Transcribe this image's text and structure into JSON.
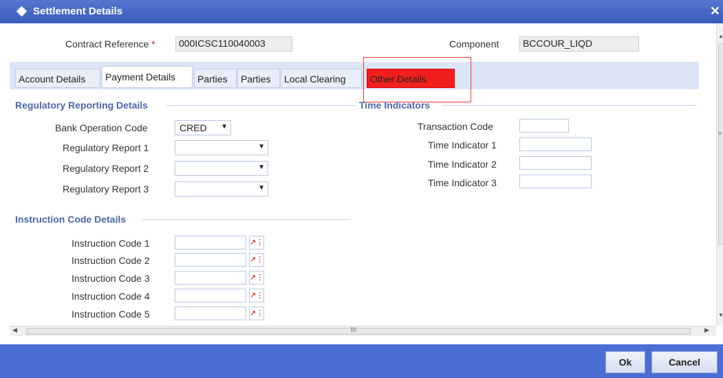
{
  "window": {
    "title": "Settlement Details",
    "close_glyph": "✕"
  },
  "header": {
    "contract_reference_label": "Contract Reference",
    "required_marker": "*",
    "contract_reference_value": "000ICSC110040003",
    "component_label": "Component",
    "component_value": "BCCOUR_LIQD"
  },
  "tabs": [
    {
      "label": "Account Details"
    },
    {
      "label": "Payment Details"
    },
    {
      "label": "Parties"
    },
    {
      "label": "Parties"
    },
    {
      "label": "Local Clearing"
    },
    {
      "label": "Other Details"
    }
  ],
  "regulatory": {
    "title": "Regulatory Reporting Details",
    "bank_operation_code_label": "Bank Operation Code",
    "bank_operation_code_value": "CRED",
    "report1_label": "Regulatory Report 1",
    "report2_label": "Regulatory Report 2",
    "report3_label": "Regulatory Report 3"
  },
  "time_indicators": {
    "title": "Time Indicators",
    "transaction_code_label": "Transaction Code",
    "ti1_label": "Time Indicator 1",
    "ti2_label": "Time Indicator 2",
    "ti3_label": "Time Indicator 3"
  },
  "instruction": {
    "title": "Instruction Code Details",
    "codes": [
      "Instruction Code 1",
      "Instruction Code 2",
      "Instruction Code 3",
      "Instruction Code 4",
      "Instruction Code 5"
    ]
  },
  "scrollbar": {
    "grip": "III"
  },
  "buttons": {
    "ok": "Ok",
    "cancel": "Cancel"
  },
  "colors": {
    "accent": "#3a5bbd",
    "tab_highlight": "#f21e1e"
  }
}
